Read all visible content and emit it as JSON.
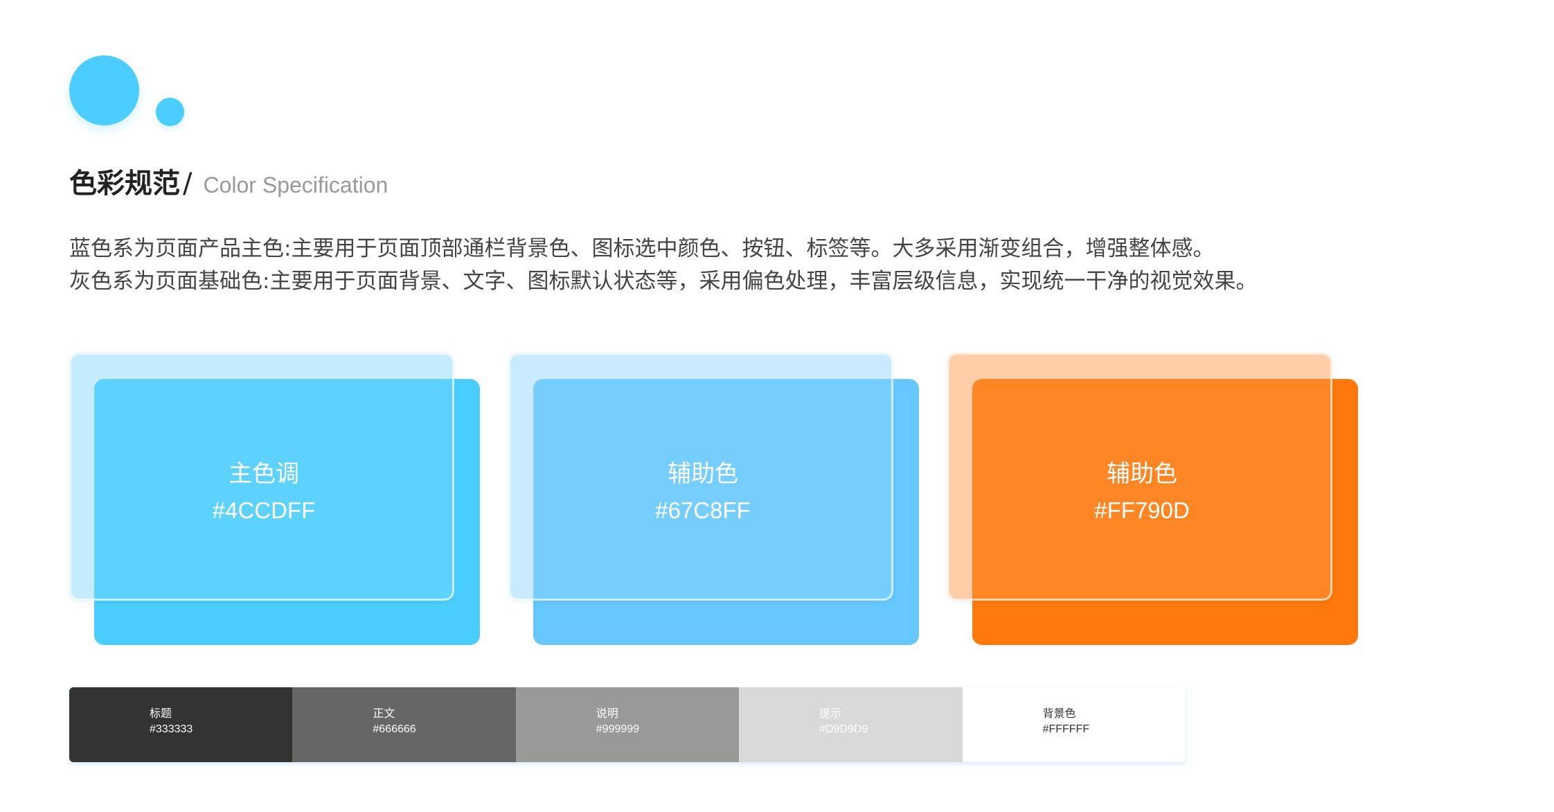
{
  "header": {
    "title_cn": "色彩规范",
    "title_slash": "/",
    "title_en": "Color Specification"
  },
  "description": [
    "蓝色系为页面产品主色:主要用于页面顶部通栏背景色、图标选中颜色、按钮、标签等。大多采用渐变组合，增强整体感。",
    "灰色系为页面基础色:主要用于页面背景、文字、图标默认状态等，采用偏色处理，丰富层级信息，实现统一干净的视觉效果。"
  ],
  "cards": [
    {
      "label": "主色调",
      "code": "#4CCDFF",
      "color": "#4CCDFF",
      "back_color": "#BFE9FF"
    },
    {
      "label": "辅助色",
      "code": "#67C8FF",
      "color": "#67C8FF",
      "back_color": "#C4E8FF"
    },
    {
      "label": "辅助色",
      "code": "#FF790D",
      "color": "#FF790D",
      "back_color": "#FFC89D"
    }
  ],
  "palette": [
    {
      "name": "标题",
      "code": "#333333",
      "color": "#333333",
      "text_color": "#FFFFFF"
    },
    {
      "name": "正文",
      "code": "#666666",
      "color": "#666666",
      "text_color": "#FFFFFF"
    },
    {
      "name": "说明",
      "code": "#999999",
      "color": "#999999",
      "text_color": "#FFFFFF"
    },
    {
      "name": "提示",
      "code": "#D9D9D9",
      "color": "#D9D9D9",
      "text_color": "#FFFFFF"
    },
    {
      "name": "背景色",
      "code": "#FFFFFF",
      "color": "#FFFFFF",
      "text_color": "#333333"
    }
  ],
  "colors": {
    "accent": "#4CCDFF"
  }
}
